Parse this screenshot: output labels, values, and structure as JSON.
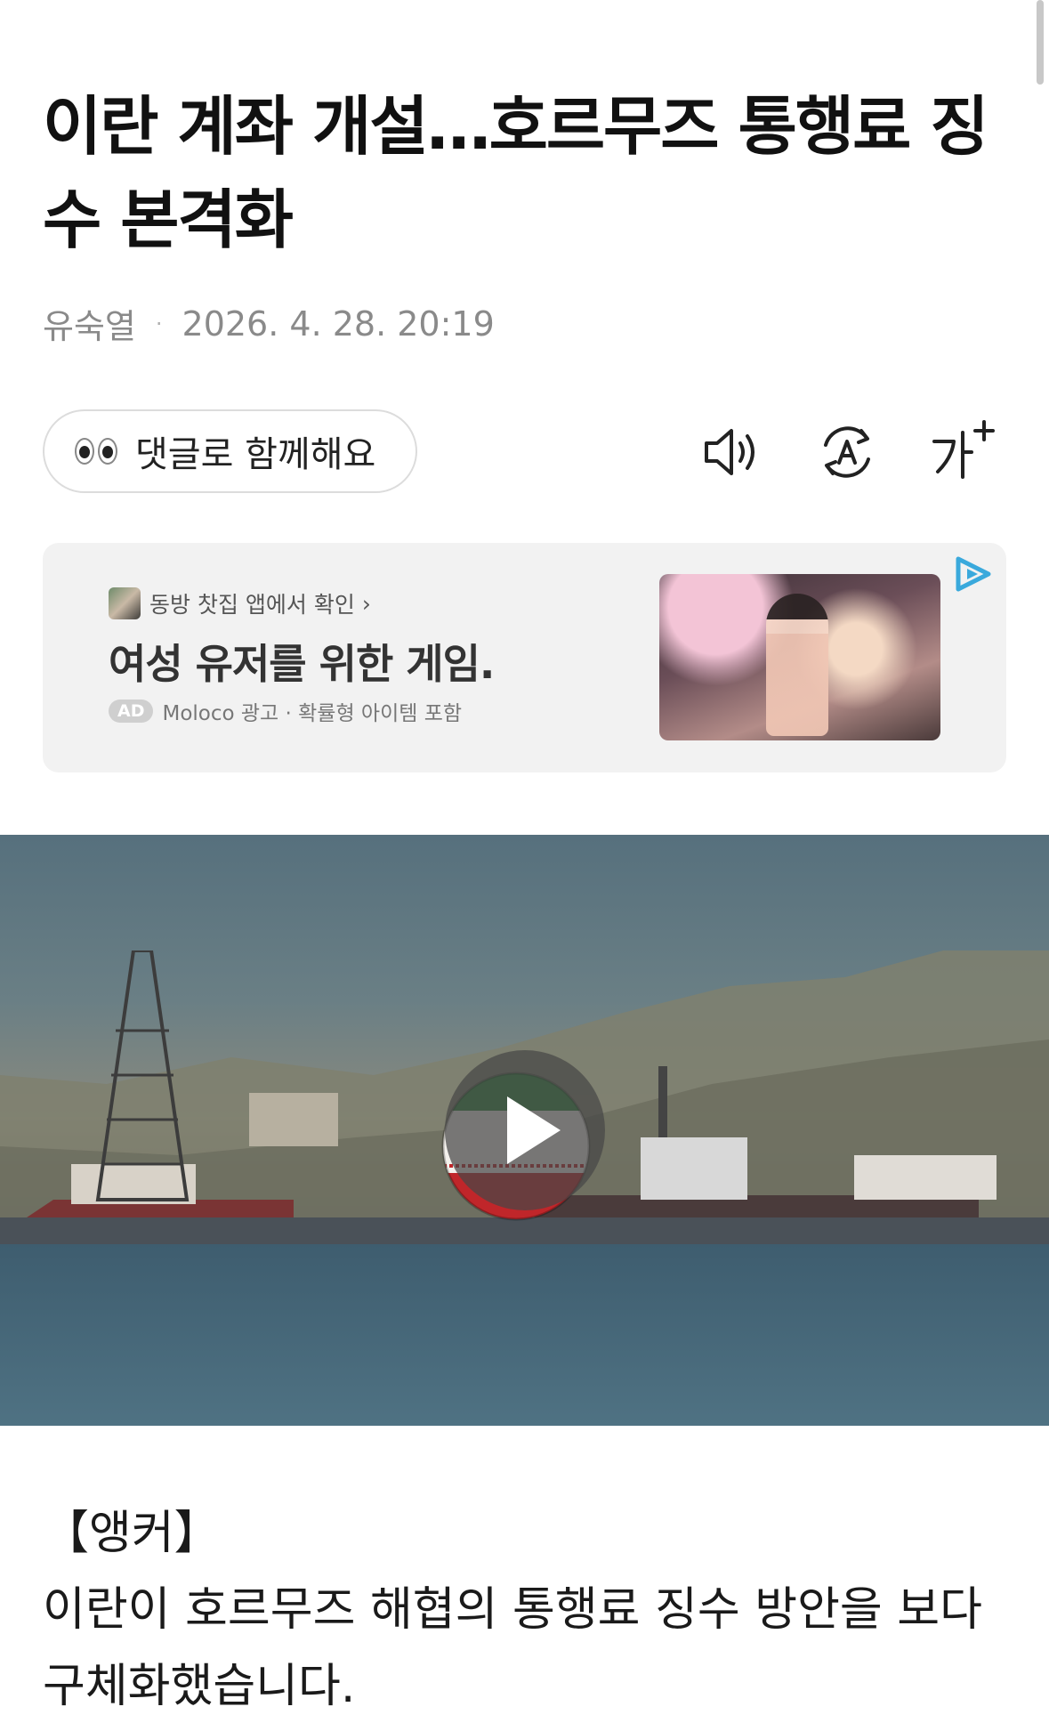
{
  "article": {
    "headline": "이란 계좌 개설…호르무즈 통행료 징수 본격화",
    "author": "유숙열",
    "separator": "·",
    "datetime": "2026. 4. 28. 20:19"
  },
  "toolbar": {
    "comment_label": "댓글로 함께해요",
    "icons": [
      "speaker-icon",
      "translate-icon",
      "font-size-icon"
    ]
  },
  "ad": {
    "source": "동방 찻집 앱에서 확인",
    "source_chevron": "›",
    "headline": "여성 유저를 위한 게임.",
    "badge": "AD",
    "meta": "Moloco 광고 · 확률형 아이템 포함"
  },
  "body": {
    "label": "【앵커】",
    "paragraph": "이란이 호르무즈 해협의 통행료 징수 방안을 보다 구체화했습니다."
  }
}
